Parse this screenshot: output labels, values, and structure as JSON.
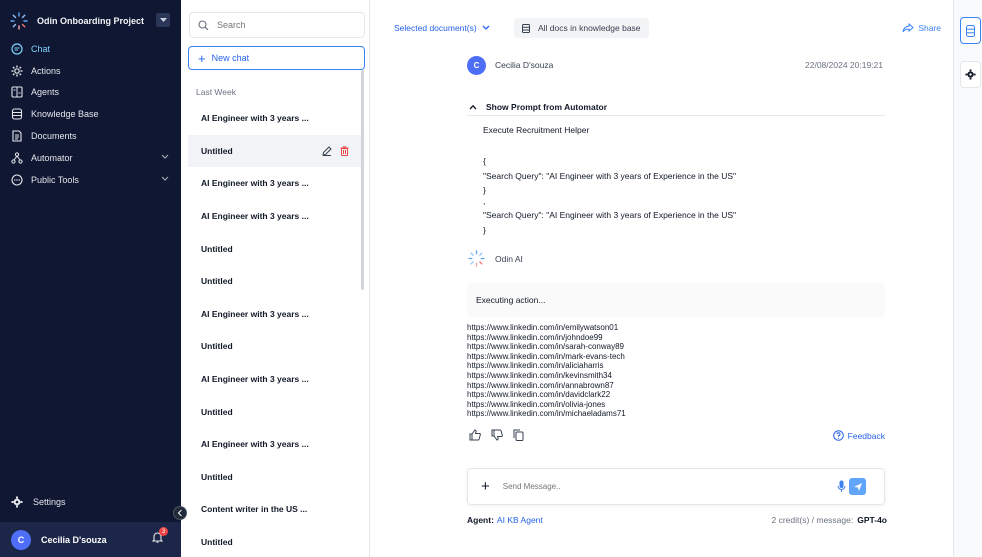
{
  "sidebar": {
    "project_name": "Odin Onboarding Project",
    "nav": [
      {
        "label": "Chat",
        "icon": "chat-icon",
        "active": true
      },
      {
        "label": "Actions",
        "icon": "gear-icon"
      },
      {
        "label": "Agents",
        "icon": "agents-icon"
      },
      {
        "label": "Knowledge Base",
        "icon": "database-icon"
      },
      {
        "label": "Documents",
        "icon": "document-icon"
      },
      {
        "label": "Automator",
        "icon": "automator-icon",
        "expandable": true
      },
      {
        "label": "Public Tools",
        "icon": "tools-icon",
        "expandable": true
      }
    ],
    "settings_label": "Settings",
    "user": {
      "initial": "C",
      "name": "Cecilia D'souza",
      "notifications": "3"
    }
  },
  "chatlist": {
    "search_placeholder": "Search",
    "new_chat_label": "New chat",
    "period_label": "Last Week",
    "chats": [
      "AI Engineer with 3 years ...",
      "Untitled",
      "AI Engineer with 3 years ...",
      "AI Engineer with 3 years ...",
      "Untitled",
      "Untitled",
      "AI Engineer with 3 years ...",
      "Untitled",
      "AI Engineer with 3 years ...",
      "Untitled",
      "AI Engineer with 3 years ...",
      "Untitled",
      "Content writer in the US ...",
      "Untitled"
    ],
    "active_index": 1
  },
  "topbar": {
    "selected_docs_label": "Selected document(s)",
    "all_docs_label": "All docs in knowledge base",
    "share_label": "Share"
  },
  "message": {
    "author_initial": "C",
    "author": "Cecilia D'souza",
    "timestamp": "22/08/2024 20:19:21",
    "prompt_toggle_label": "Show Prompt from Automator",
    "prompt_lines": [
      "Execute Recruitment Helper",
      "{",
      "\"Search Query\": \"AI Engineer with 3 years of Experience in the US\"",
      "}",
      ",",
      "\"Search Query\": \"AI Engineer with 3 years of Experience in the US\"",
      "}"
    ]
  },
  "response": {
    "bot_name": "Odin AI",
    "status": "Executing action...",
    "links": [
      "https://www.linkedin.com/in/emilywatson01",
      "https://www.linkedin.com/in/johndoe99",
      "https://www.linkedin.com/in/sarah-conway89",
      "https://www.linkedin.com/in/mark-evans-tech",
      "https://www.linkedin.com/in/aliciaharris",
      "https://www.linkedin.com/in/kevinsmith34",
      "https://www.linkedin.com/in/annabrown87",
      "https://www.linkedin.com/in/davidclark22",
      "https://www.linkedin.com/in/olivia-jones",
      "https://www.linkedin.com/in/michaeladams71"
    ],
    "feedback_label": "Feedback"
  },
  "composer": {
    "placeholder": "Send Message..",
    "agent_label": "Agent:",
    "agent_value": "AI KB Agent",
    "credits": "2 credit(s) / message:",
    "model": "GPT-4o"
  },
  "colors": {
    "sidebar_bg": "#0f1733",
    "accent": "#2563eb",
    "send": "#60a5fa",
    "delete": "#ef4444"
  }
}
